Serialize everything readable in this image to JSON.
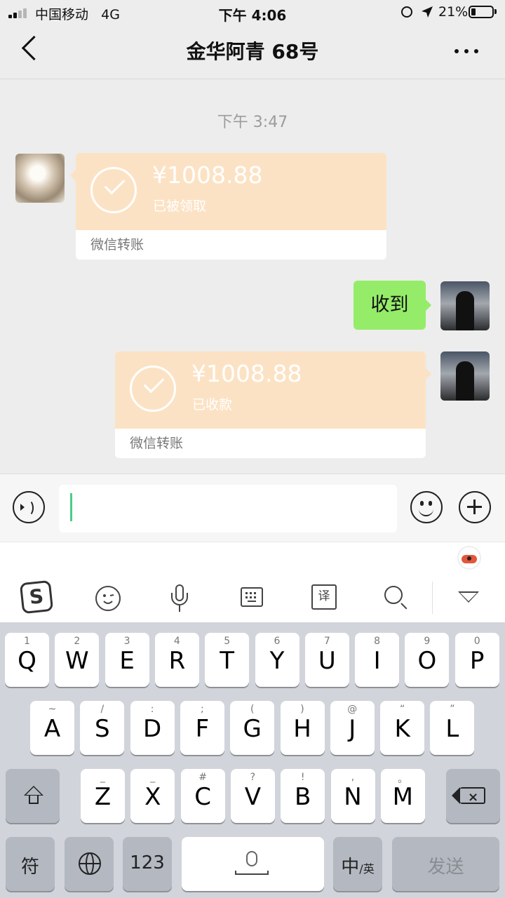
{
  "status_bar": {
    "carrier": "中国移动",
    "network": "4G",
    "time": "下午 4:06",
    "battery": "21%"
  },
  "nav": {
    "title": "金华阿青 68号"
  },
  "chat": {
    "timestamp": "下午 3:47",
    "messages": [
      {
        "type": "transfer",
        "side": "left",
        "amount": "¥1008.88",
        "status": "已被领取",
        "footer": "微信转账"
      },
      {
        "type": "text",
        "side": "right",
        "text": "收到"
      },
      {
        "type": "transfer",
        "side": "right",
        "amount": "¥1008.88",
        "status": "已收款",
        "footer": "微信转账"
      }
    ]
  },
  "ime_toolbar": {
    "sogou_glyph": "S",
    "translate_glyph": "译"
  },
  "keyboard": {
    "row1": [
      {
        "k": "Q",
        "s": "1"
      },
      {
        "k": "W",
        "s": "2"
      },
      {
        "k": "E",
        "s": "3"
      },
      {
        "k": "R",
        "s": "4"
      },
      {
        "k": "T",
        "s": "5"
      },
      {
        "k": "Y",
        "s": "6"
      },
      {
        "k": "U",
        "s": "7"
      },
      {
        "k": "I",
        "s": "8"
      },
      {
        "k": "O",
        "s": "9"
      },
      {
        "k": "P",
        "s": "0"
      }
    ],
    "row2": [
      {
        "k": "A",
        "s": "~"
      },
      {
        "k": "S",
        "s": "/"
      },
      {
        "k": "D",
        "s": ":"
      },
      {
        "k": "F",
        "s": ";"
      },
      {
        "k": "G",
        "s": "("
      },
      {
        "k": "H",
        "s": ")"
      },
      {
        "k": "J",
        "s": "@"
      },
      {
        "k": "K",
        "s": "“"
      },
      {
        "k": "L",
        "s": "”"
      }
    ],
    "row3": [
      {
        "k": "Z",
        "s": "_"
      },
      {
        "k": "X",
        "s": "_"
      },
      {
        "k": "C",
        "s": "#"
      },
      {
        "k": "V",
        "s": "?"
      },
      {
        "k": "B",
        "s": "!"
      },
      {
        "k": "N",
        "s": ","
      },
      {
        "k": "M",
        "s": "。"
      }
    ],
    "symbols_key": "符",
    "num_key": "123",
    "lang_key": "中",
    "lang_key_sub": "/英",
    "send_key": "发送"
  },
  "colors": {
    "transfer_bg": "#fce2c4",
    "text_bubble_bg": "#95ec69",
    "caret": "#4ecb8b"
  }
}
